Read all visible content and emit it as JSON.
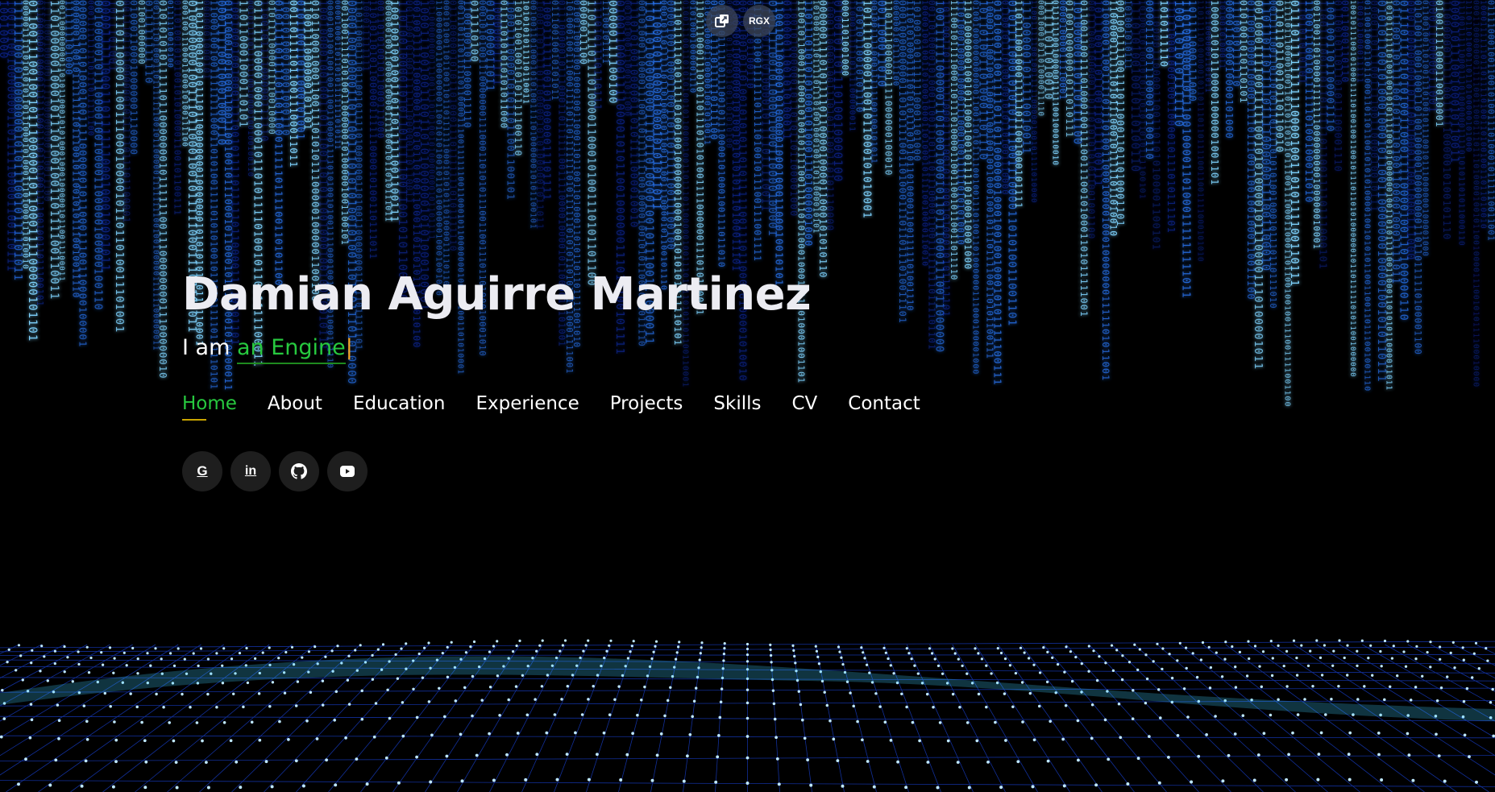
{
  "top_controls": {
    "popout_icon": "external-window-icon",
    "badge_label": "RGX"
  },
  "hero": {
    "name": "Damian Aguirre Martinez",
    "tagline_prefix": "I am",
    "tagline_typed": "an Engine",
    "tagline_cursor": "|"
  },
  "nav": {
    "items": [
      {
        "label": "Home",
        "active": true
      },
      {
        "label": "About",
        "active": false
      },
      {
        "label": "Education",
        "active": false
      },
      {
        "label": "Experience",
        "active": false
      },
      {
        "label": "Projects",
        "active": false
      },
      {
        "label": "Skills",
        "active": false
      },
      {
        "label": "CV",
        "active": false
      },
      {
        "label": "Contact",
        "active": false
      }
    ]
  },
  "socials": [
    {
      "icon": "google-icon"
    },
    {
      "icon": "linkedin-icon"
    },
    {
      "icon": "github-icon"
    },
    {
      "icon": "youtube-icon"
    }
  ],
  "colors": {
    "background": "#000000",
    "accent_green": "#27c93f",
    "cursor_orange": "#f5a623",
    "underline_gold": "#c8a400",
    "rain_blue": "#1a5cff",
    "grid_cyan": "#3fd0ff"
  }
}
